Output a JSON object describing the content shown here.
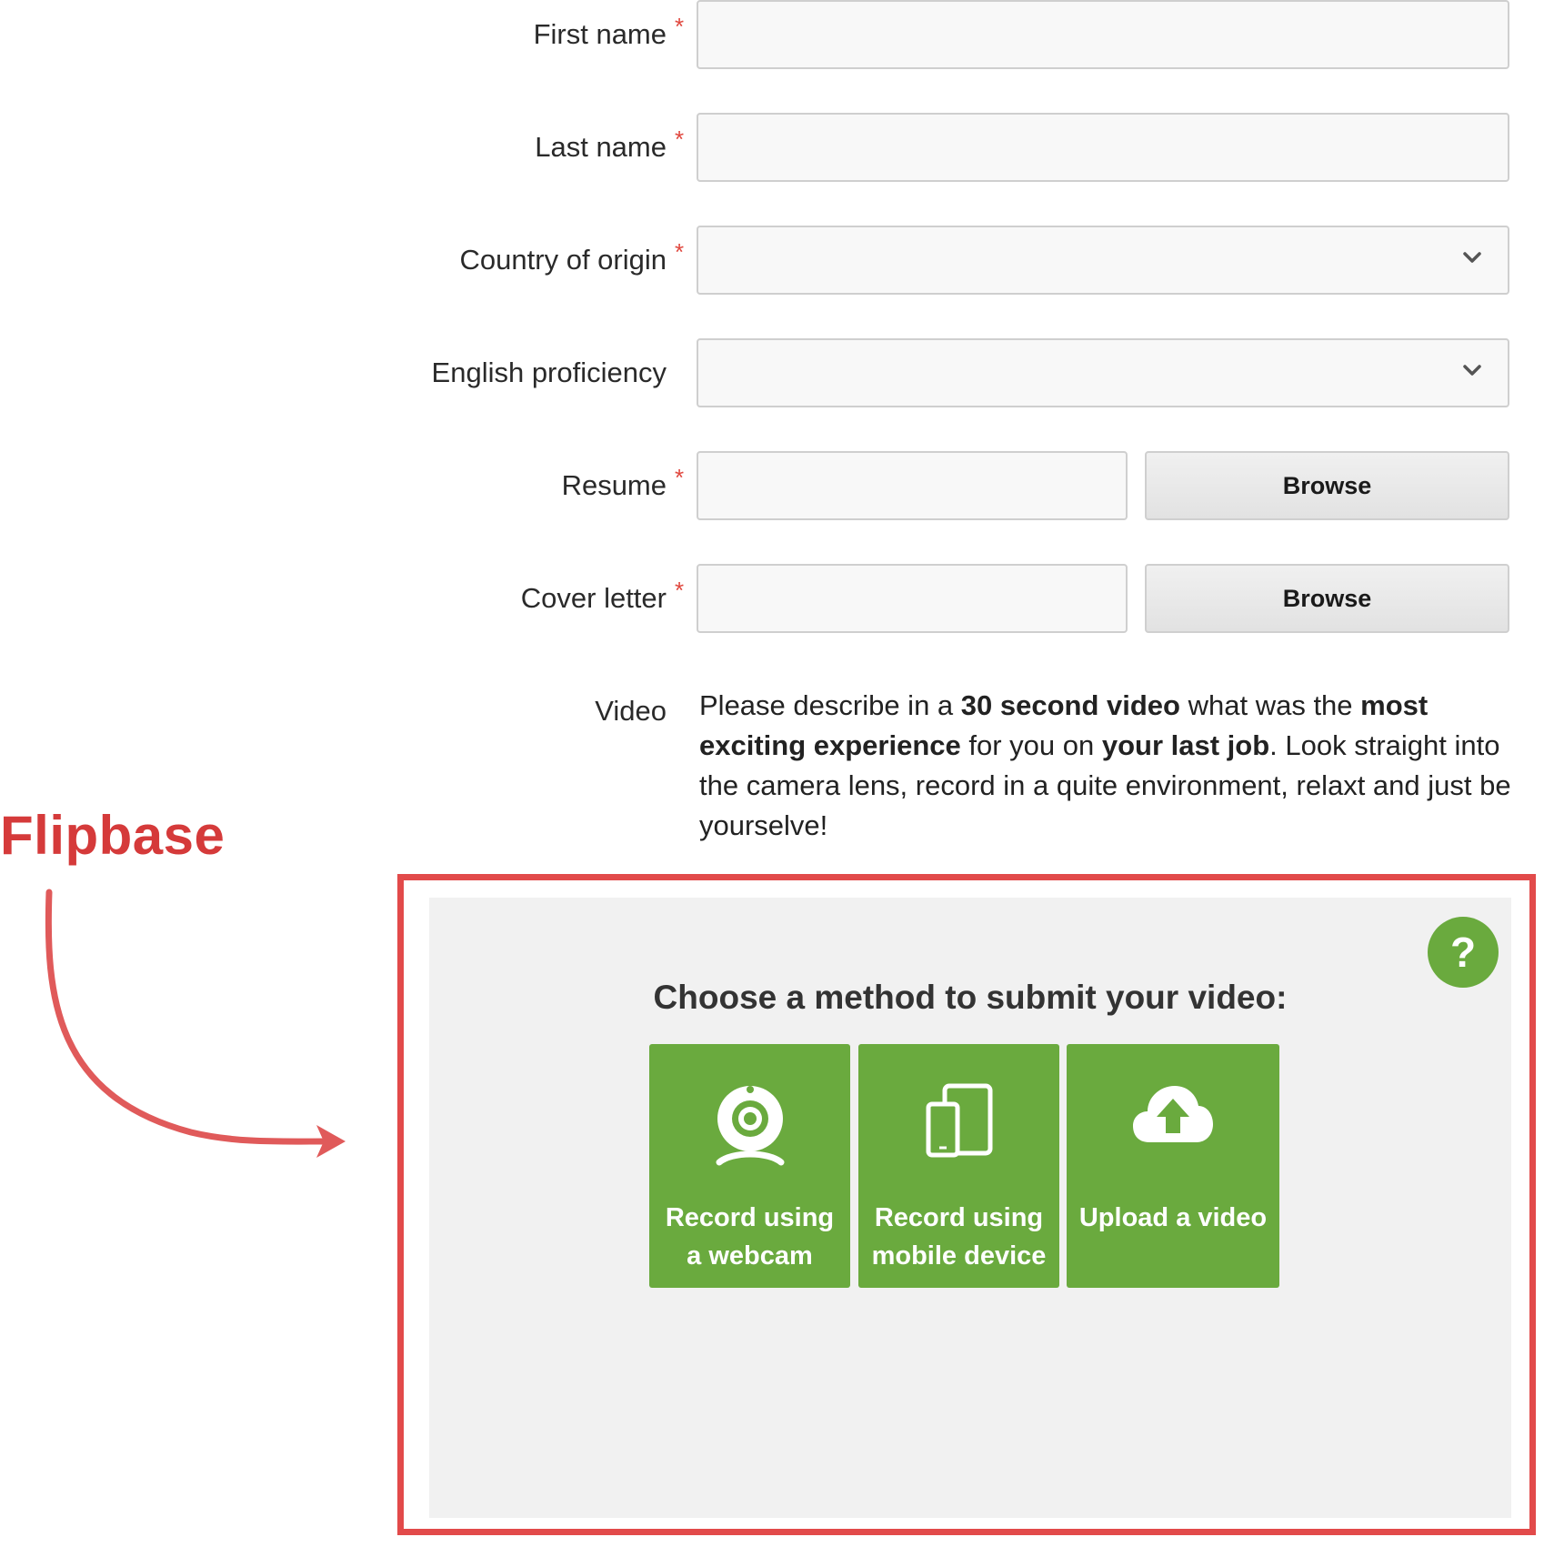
{
  "form": {
    "first_name_label": "First name",
    "last_name_label": "Last name",
    "country_label": "Country of origin",
    "english_label": "English proficiency",
    "resume_label": "Resume",
    "cover_letter_label": "Cover letter",
    "video_label": "Video",
    "required_mark": "*",
    "browse_label": "Browse",
    "first_name_value": "",
    "last_name_value": "",
    "country_value": "",
    "english_value": "",
    "resume_value": "",
    "cover_letter_value": ""
  },
  "video_description": {
    "t1": "Please describe in a ",
    "b1": "30 second video",
    "t2": " what was the ",
    "b2": "most exciting experience",
    "t3": " for you on ",
    "b3": "your last job",
    "t4": ". Look straight into the camera lens, record in a quite environment, relaxt and just be yourselve!"
  },
  "annotation": {
    "brand_label": "Flipbase",
    "color": "#d53a3a"
  },
  "widget": {
    "title": "Choose a method to submit your video:",
    "help_label": "?",
    "accent": "#6aaa3e",
    "methods": [
      {
        "label": "Record using\na webcam",
        "icon": "webcam-icon"
      },
      {
        "label": "Record using\nmobile device",
        "icon": "mobile-device-icon"
      },
      {
        "label": "Upload a video",
        "icon": "cloud-upload-icon"
      }
    ]
  }
}
